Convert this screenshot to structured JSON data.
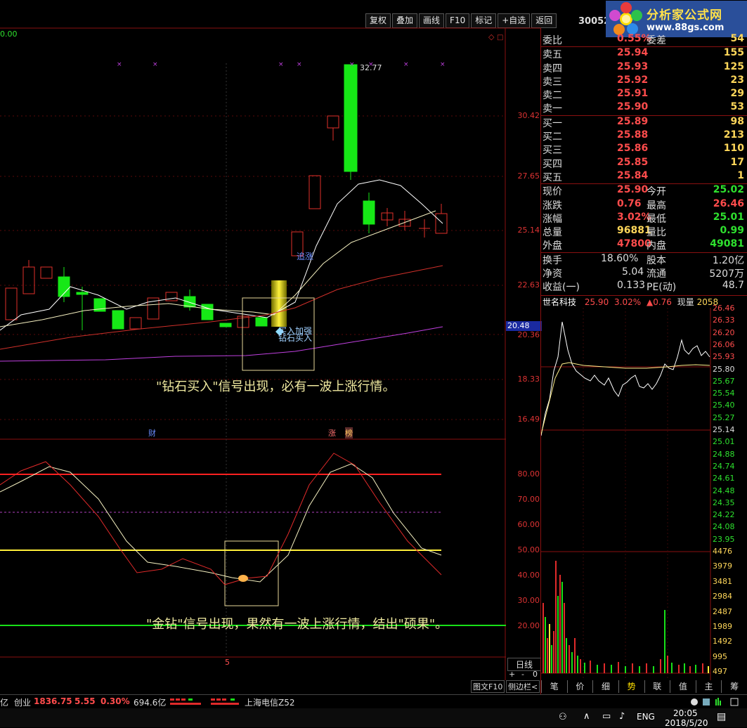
{
  "toolbar": {
    "buttons": [
      "复权",
      "叠加",
      "画线",
      "F10",
      "标记",
      "+自选",
      "返回"
    ]
  },
  "stock_code": "30052",
  "logo": {
    "title": "分析家公式网",
    "url": "www.88gs.com"
  },
  "top_left_value": "0.00",
  "main_chart": {
    "high_label": "32.77",
    "annotations": {
      "chase": "追涨",
      "buy_add": "买入加强",
      "diamond_buy": "钻石买入"
    },
    "caption": "\"钻石买入\"信号出现，必有一波上涨行情。",
    "y_ticks": [
      "30.42",
      "27.65",
      "25.14",
      "22.63",
      "20.36",
      "18.33",
      "16.49"
    ],
    "current_price_tag": "20.48",
    "markers": {
      "cai": "财",
      "zhang": "涨",
      "bang": "榜"
    }
  },
  "indicator_chart": {
    "y_ticks": [
      "80.00",
      "70.00",
      "60.00",
      "50.00",
      "40.00",
      "30.00",
      "20.00"
    ],
    "caption": "\"金钻\"信号出现，果然有一波上涨行情，结出\"硕果\"。",
    "x_marker": "5"
  },
  "quote": {
    "weibi": {
      "label": "委比",
      "value": "0.55%",
      "label2": "委差",
      "value2": "54"
    },
    "asks": [
      {
        "label": "卖五",
        "price": "25.94",
        "vol": "155"
      },
      {
        "label": "卖四",
        "price": "25.93",
        "vol": "125"
      },
      {
        "label": "卖三",
        "price": "25.92",
        "vol": "23"
      },
      {
        "label": "卖二",
        "price": "25.91",
        "vol": "29"
      },
      {
        "label": "卖一",
        "price": "25.90",
        "vol": "53"
      }
    ],
    "bids": [
      {
        "label": "买一",
        "price": "25.89",
        "vol": "98"
      },
      {
        "label": "买二",
        "price": "25.88",
        "vol": "213"
      },
      {
        "label": "买三",
        "price": "25.86",
        "vol": "110"
      },
      {
        "label": "买四",
        "price": "25.85",
        "vol": "17"
      },
      {
        "label": "买五",
        "price": "25.84",
        "vol": "1"
      }
    ],
    "stats": [
      {
        "l1": "现价",
        "v1": "25.90",
        "c1": "#ff4c4c",
        "l2": "今开",
        "v2": "25.02",
        "c2": "#2ee02e"
      },
      {
        "l1": "涨跌",
        "v1": "0.76",
        "c1": "#ff4c4c",
        "l2": "最高",
        "v2": "26.46",
        "c2": "#ff4c4c"
      },
      {
        "l1": "涨幅",
        "v1": "3.02%",
        "c1": "#ff4c4c",
        "l2": "最低",
        "v2": "25.01",
        "c2": "#2ee02e"
      },
      {
        "l1": "总量",
        "v1": "96881",
        "c1": "#ffd75a",
        "l2": "量比",
        "v2": "0.99",
        "c2": "#2ee02e"
      },
      {
        "l1": "外盘",
        "v1": "47800",
        "c1": "#ff4c4c",
        "l2": "内盘",
        "v2": "49081",
        "c2": "#2ee02e"
      }
    ],
    "fundamentals": [
      {
        "l1": "换手",
        "v1": "18.60%",
        "l2": "股本",
        "v2": "1.20亿"
      },
      {
        "l1": "净资",
        "v1": "5.04",
        "l2": "流通",
        "v2": "5207万"
      },
      {
        "l1": "收益(一)",
        "v1": "0.133",
        "l2": "PE(动)",
        "v2": "48.7"
      }
    ]
  },
  "intraday": {
    "header": {
      "name": "世名科技",
      "price": "25.90",
      "pct": "3.02%",
      "chg": "▲0.76",
      "vol_label": "现量",
      "vol": "2058"
    },
    "price_ticks": [
      "26.46",
      "26.33",
      "26.20",
      "26.06",
      "25.93",
      "25.80",
      "25.67",
      "25.54",
      "25.40",
      "25.27",
      "25.14",
      "25.01",
      "24.88",
      "24.74",
      "24.61",
      "24.48",
      "24.35",
      "24.22",
      "24.08",
      "23.95"
    ],
    "volume_ticks": [
      "4476",
      "3979",
      "3481",
      "2984",
      "2487",
      "1989",
      "1492",
      "995",
      "497"
    ]
  },
  "tabs": [
    "笔",
    "价",
    "细",
    "势",
    "联",
    "值",
    "主",
    "筹"
  ],
  "bottom_controls": {
    "period": "日线",
    "plus": "+",
    "minus": "-",
    "zero": "0",
    "f10": "图文F10",
    "sidebar": "侧边栏<"
  },
  "statusbar": {
    "prefix": "亿",
    "chuangye_label": "创业",
    "chuangye_value": "1836.75",
    "chuangye_chg": "5.55",
    "chuangye_pct": "0.30%",
    "turnover": "694.6亿",
    "network": "上海电信Z52"
  },
  "taskbar": {
    "lang": "ENG",
    "time": "20:05",
    "date": "2018/5/20"
  }
}
